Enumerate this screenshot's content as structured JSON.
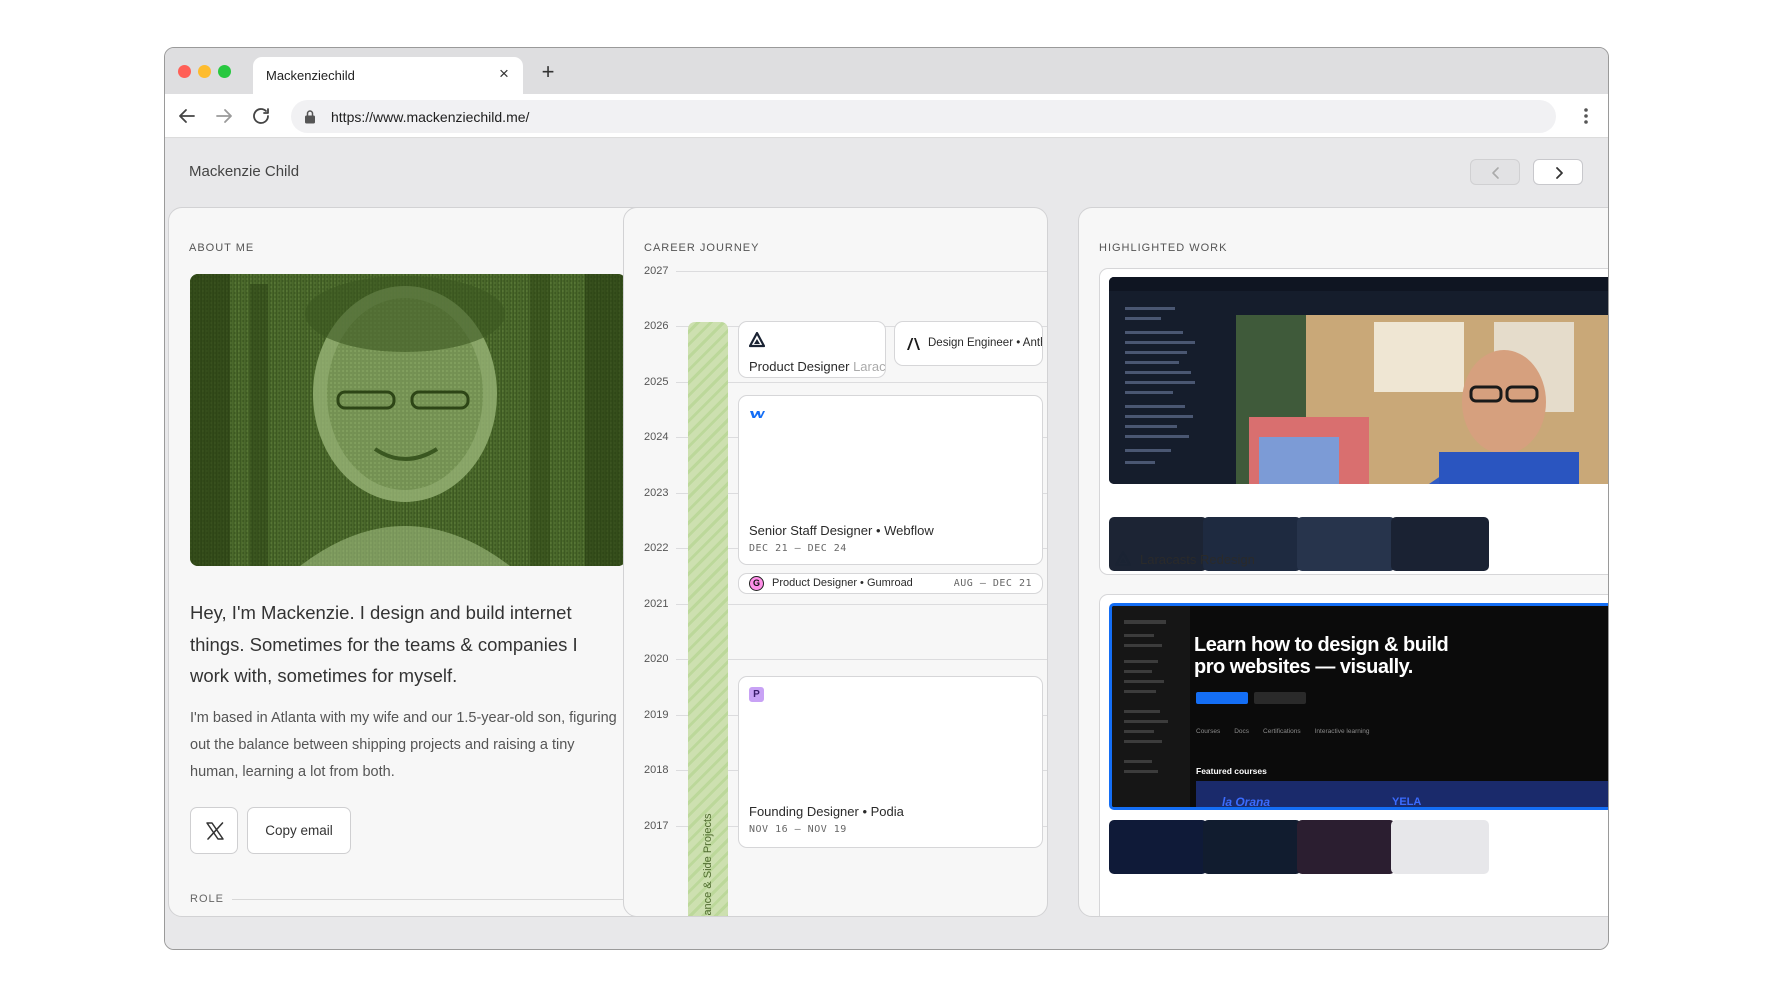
{
  "browser": {
    "tab_title": "Mackenziechild",
    "close_glyph": "×",
    "newtab_glyph": "+",
    "url": "https://www.mackenziechild.me/",
    "traffic_lights": [
      "#ff5f57",
      "#febc2e",
      "#28c840"
    ]
  },
  "header": {
    "site_name": "Mackenzie Child"
  },
  "about": {
    "label": "ABOUT ME",
    "lead": "Hey, I'm Mackenzie. I design and build internet things. Sometimes for the teams & companies I work with, sometimes for myself.",
    "body": "I'm based in Atlanta with my wife and our 1.5-year-old son, figuring out the balance between shipping projects and raising a tiny human, learning a lot from both.",
    "x_button_glyph": "𝕏",
    "copy_email_label": "Copy email",
    "role_label": "ROLE"
  },
  "career": {
    "label": "CAREER JOURNEY",
    "years": [
      "2027",
      "2026",
      "2025",
      "2024",
      "2023",
      "2022",
      "2021",
      "2020",
      "2019",
      "2018",
      "2017"
    ],
    "side_label": "lance & Side Projects",
    "jobs": [
      {
        "title": "Product Designer",
        "company_partial": "Larac"
      },
      {
        "title": "Design Engineer • Anth"
      },
      {
        "title": "Senior Staff Designer • Webflow",
        "date": "DEC 21 — DEC 24"
      },
      {
        "title": "Product Designer • Gumroad",
        "date": "AUG — DEC 21",
        "badge": "G"
      },
      {
        "title": "Founding Designer • Podia",
        "date": "NOV 16 — NOV 19",
        "badge": "P"
      }
    ]
  },
  "work": {
    "label": "HIGHLIGHTED WORK",
    "items": [
      {
        "title": "Laracasts Redesign"
      },
      {
        "headline_line1": "Learn how to design & build",
        "headline_line2": "pro websites — visually.",
        "section": "Featured courses",
        "course_tag": "la Orana",
        "course_tag2": "YELA",
        "nav_items": [
          "Courses",
          "Docs",
          "Certifications",
          "Interactive learning"
        ]
      }
    ]
  },
  "colors": {
    "accent_green": "#bcd89a",
    "webflow_blue": "#146ef5",
    "gumroad_pink": "#ff90e8",
    "podia_purple": "#c8a2f5"
  }
}
